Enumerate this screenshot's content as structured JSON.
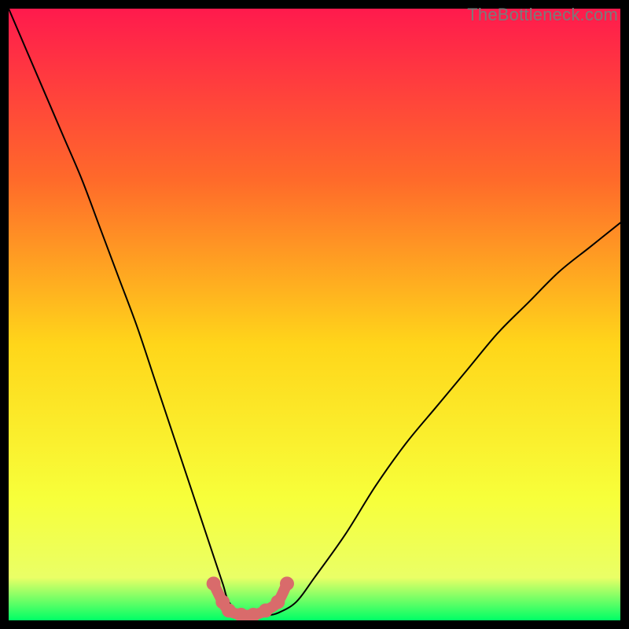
{
  "watermark": "TheBottleneck.com",
  "colors": {
    "bg": "#000000",
    "grad_top": "#ff1a4d",
    "grad_upper_mid": "#ff6a2a",
    "grad_mid": "#ffd61a",
    "grad_lower_mid": "#f7ff3a",
    "grad_low": "#eaff66",
    "grad_bottom": "#00ff66",
    "curve": "#000000",
    "marker_stroke": "#d96b6b",
    "marker_fill": "#d96b6b"
  },
  "chart_data": {
    "type": "line",
    "title": "",
    "xlabel": "",
    "ylabel": "",
    "xlim": [
      0,
      100
    ],
    "ylim": [
      0,
      100
    ],
    "series": [
      {
        "name": "bottleneck-curve",
        "x": [
          0,
          3,
          6,
          9,
          12,
          15,
          18,
          21,
          24,
          27,
          30,
          33,
          35,
          36,
          38,
          40,
          42,
          44,
          47,
          50,
          55,
          60,
          65,
          70,
          75,
          80,
          85,
          90,
          95,
          100
        ],
        "y": [
          100,
          93,
          86,
          79,
          72,
          64,
          56,
          48,
          39,
          30,
          21,
          12,
          6,
          3,
          1.2,
          0.8,
          0.8,
          1.2,
          3,
          7,
          14,
          22,
          29,
          35,
          41,
          47,
          52,
          57,
          61,
          65
        ]
      }
    ],
    "highlight_segment": {
      "name": "optimal-zone",
      "x": [
        33.5,
        35,
        36,
        38,
        40,
        42,
        44,
        45.5
      ],
      "y": [
        6,
        3,
        1.6,
        0.9,
        0.9,
        1.6,
        3,
        6
      ]
    }
  }
}
